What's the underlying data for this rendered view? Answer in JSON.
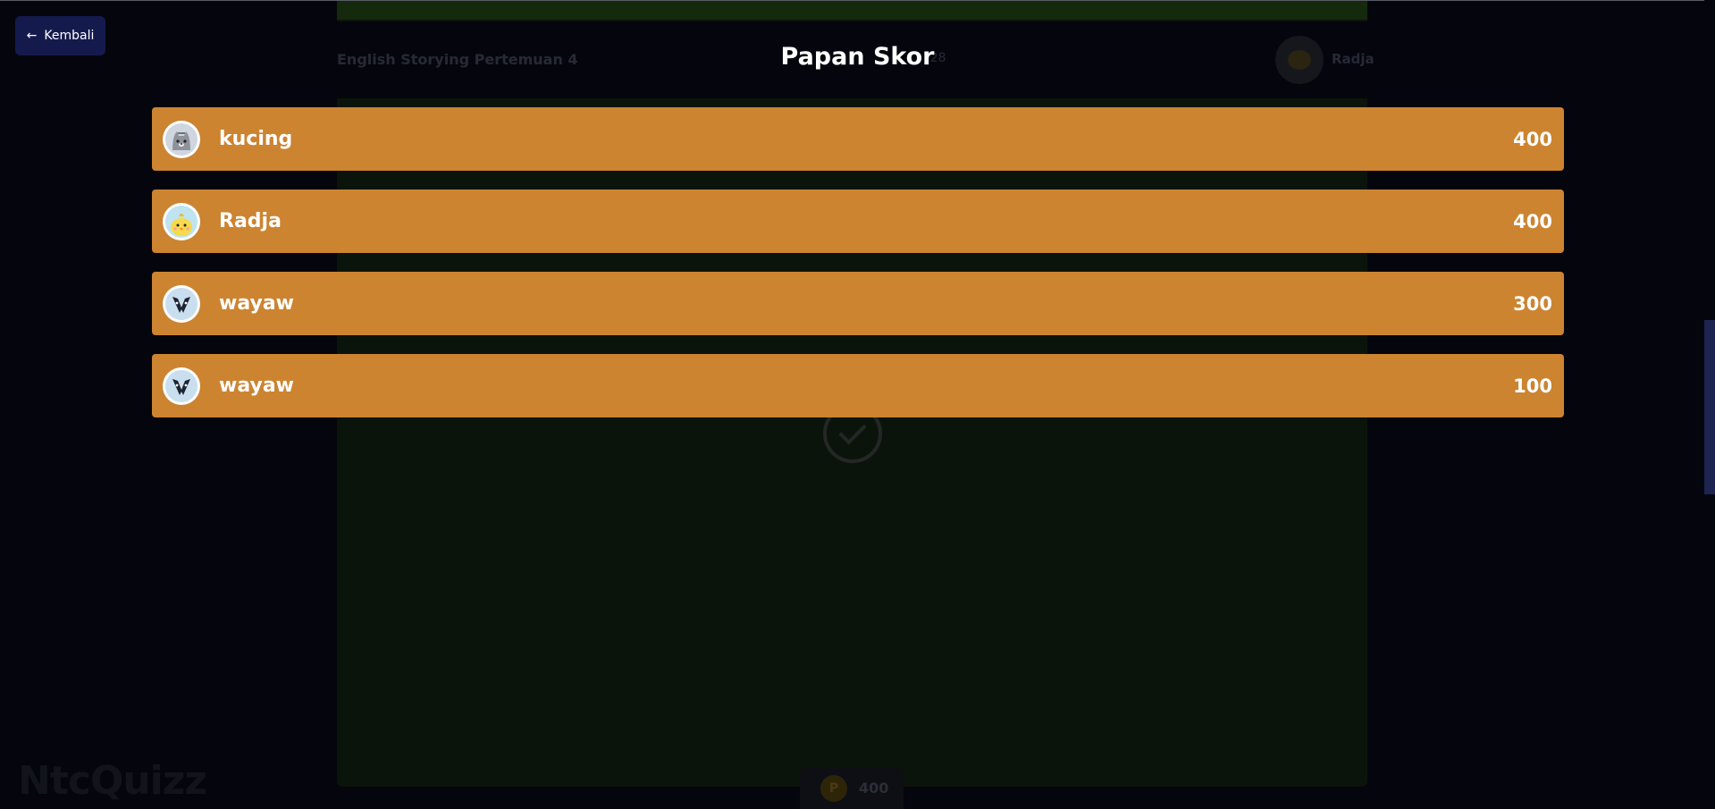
{
  "background": {
    "quiz_title": "English Storying Pertemuan 4",
    "timer": ":28",
    "username": "Radja",
    "points": "400",
    "coin_letter": "P",
    "logo": "NtcQuizz"
  },
  "back_button": {
    "icon": "arrow-left-icon",
    "label": "Kembali"
  },
  "scoreboard": {
    "title": "Papan Skor",
    "row_color": "#cc8431",
    "players": [
      {
        "name": "kucing",
        "score": "400",
        "avatar": "cat-avatar-icon"
      },
      {
        "name": "Radja",
        "score": "400",
        "avatar": "chick-avatar-icon"
      },
      {
        "name": "wayaw",
        "score": "300",
        "avatar": "badger-avatar-icon"
      },
      {
        "name": "wayaw",
        "score": "100",
        "avatar": "badger-avatar-icon"
      }
    ]
  }
}
